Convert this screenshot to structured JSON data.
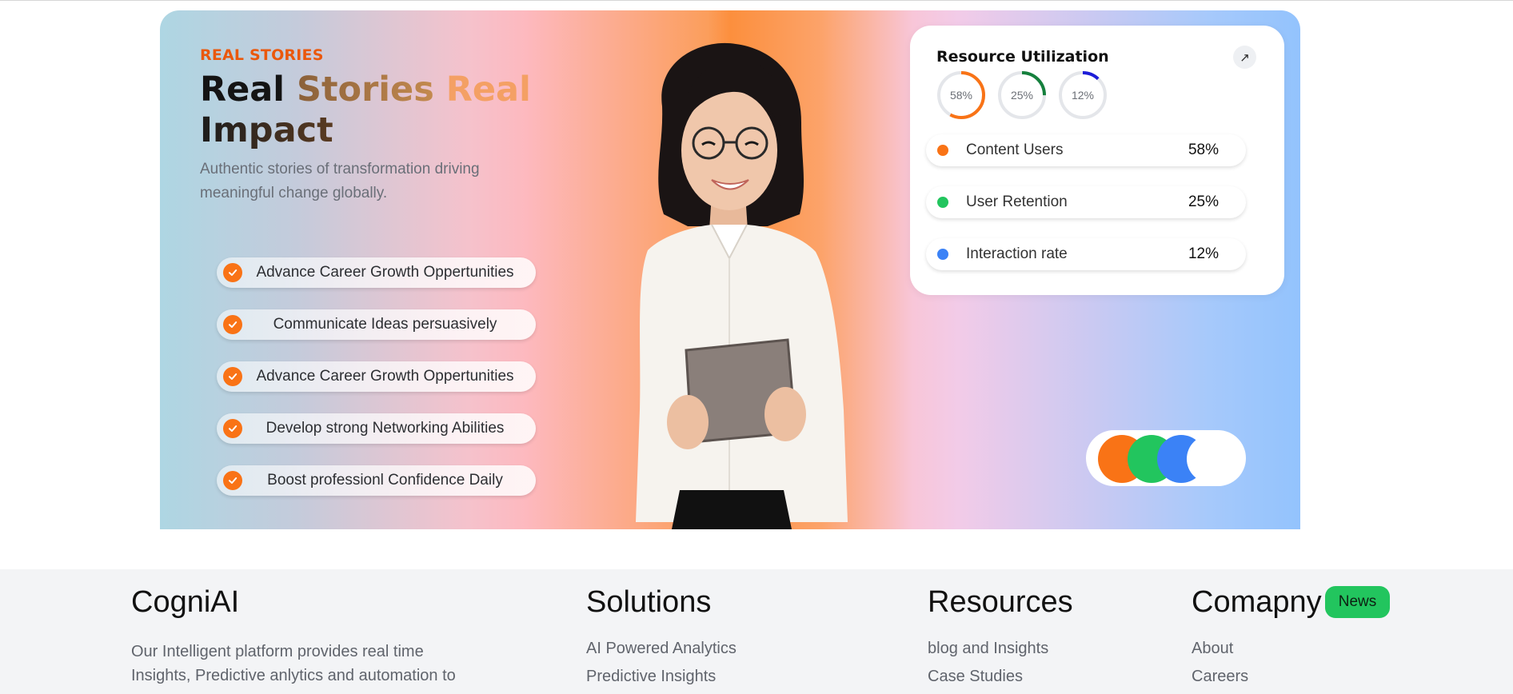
{
  "hero": {
    "eyebrow": "REAL STORIES",
    "headline": {
      "w1": "Real",
      "w2": "Stories",
      "w3": "Real",
      "w4": "Impact"
    },
    "subtext": "Authentic stories of transformation driving meaningful change globally.",
    "features": [
      "Advance Career Growth Oppertunities",
      "Communicate Ideas persuasively",
      "Advance Career Growth Oppertunities",
      "Develop strong Networking Abilities",
      "Boost professionl Confidence Daily"
    ]
  },
  "resource_card": {
    "title": "Resource Utilization",
    "expand_icon": "↗",
    "rings": [
      {
        "label": "58%",
        "value": 58,
        "color": "#f97316"
      },
      {
        "label": "25%",
        "value": 25,
        "color": "#15803d"
      },
      {
        "label": "12%",
        "value": 12,
        "color": "#1d1dd8"
      }
    ],
    "metrics": [
      {
        "label": "Content Users",
        "value": "58%",
        "color": "#f97316"
      },
      {
        "label": "User Retention",
        "value": "25%",
        "color": "#22c55e"
      },
      {
        "label": "Interaction rate",
        "value": "12%",
        "color": "#3b82f6"
      }
    ]
  },
  "toggle_colors": [
    "#f97316",
    "#22c55e",
    "#3b82f6",
    "#ffffff"
  ],
  "footer": {
    "brand": "CogniAI",
    "description": "Our Intelligent platform provides real time Insights, Predictive anlytics and automation to",
    "solutions": {
      "heading": "Solutions",
      "links": [
        "AI Powered Analytics",
        "Predictive Insights"
      ]
    },
    "resources": {
      "heading": "Resources",
      "links": [
        "blog and Insights",
        "Case Studies"
      ]
    },
    "company": {
      "heading": "Comapny",
      "badge": "News",
      "links": [
        "About",
        "Careers"
      ]
    }
  }
}
